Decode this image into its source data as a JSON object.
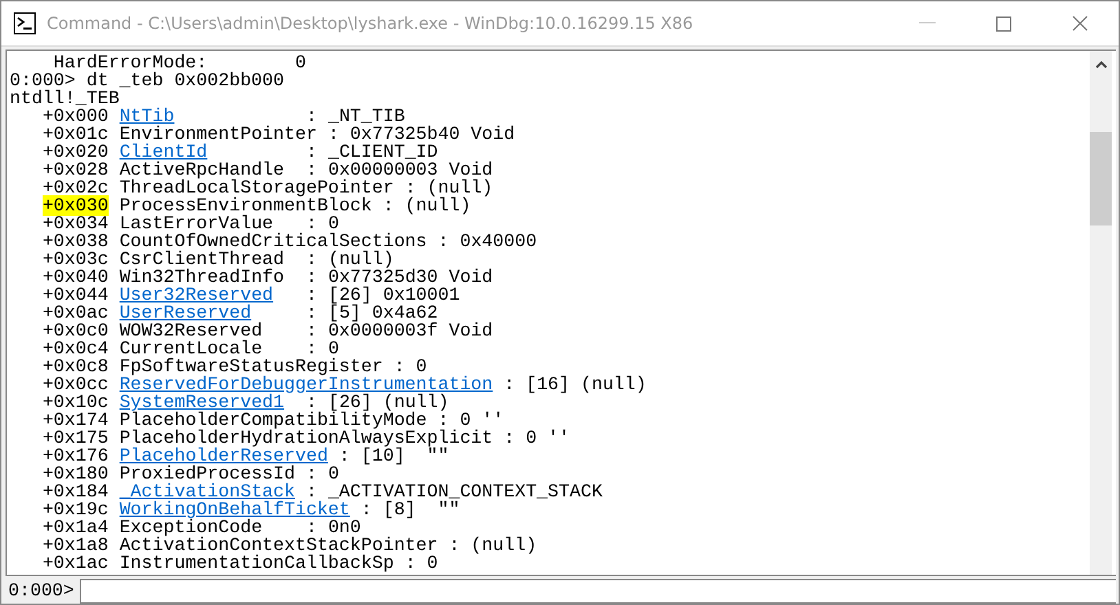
{
  "window": {
    "title": "Command - C:\\Users\\admin\\Desktop\\lyshark.exe - WinDbg:10.0.16299.15 X86"
  },
  "output": [
    {
      "kind": "plain",
      "text": "    HardErrorMode:        0"
    },
    {
      "kind": "plain",
      "text": "0:000> dt _teb 0x002bb000"
    },
    {
      "kind": "plain",
      "text": "ntdll!_TEB"
    },
    {
      "kind": "field",
      "offset": "+0x000",
      "name": "NtTib",
      "link": true,
      "value": ": _NT_TIB",
      "highlighted": false
    },
    {
      "kind": "field",
      "offset": "+0x01c",
      "name": "EnvironmentPointer",
      "link": false,
      "value": ": 0x77325b40 Void",
      "highlighted": false
    },
    {
      "kind": "field",
      "offset": "+0x020",
      "name": "ClientId",
      "link": true,
      "value": ": _CLIENT_ID",
      "highlighted": false
    },
    {
      "kind": "field",
      "offset": "+0x028",
      "name": "ActiveRpcHandle",
      "link": false,
      "value": ": 0x00000003 Void",
      "highlighted": false
    },
    {
      "kind": "field",
      "offset": "+0x02c",
      "name": "ThreadLocalStoragePointer",
      "link": false,
      "value": ": (null)",
      "highlighted": false
    },
    {
      "kind": "field",
      "offset": "+0x030",
      "name": "ProcessEnvironmentBlock",
      "link": false,
      "value": ": (null)",
      "highlighted": true
    },
    {
      "kind": "field",
      "offset": "+0x034",
      "name": "LastErrorValue",
      "link": false,
      "value": ": 0",
      "highlighted": false
    },
    {
      "kind": "field",
      "offset": "+0x038",
      "name": "CountOfOwnedCriticalSections",
      "link": false,
      "value": ": 0x40000",
      "highlighted": false
    },
    {
      "kind": "field",
      "offset": "+0x03c",
      "name": "CsrClientThread",
      "link": false,
      "value": ": (null)",
      "highlighted": false
    },
    {
      "kind": "field",
      "offset": "+0x040",
      "name": "Win32ThreadInfo",
      "link": false,
      "value": ": 0x77325d30 Void",
      "highlighted": false
    },
    {
      "kind": "field",
      "offset": "+0x044",
      "name": "User32Reserved",
      "link": true,
      "value": ": [26] 0x10001",
      "highlighted": false
    },
    {
      "kind": "field",
      "offset": "+0x0ac",
      "name": "UserReserved",
      "link": true,
      "value": ": [5] 0x4a62",
      "highlighted": false
    },
    {
      "kind": "field",
      "offset": "+0x0c0",
      "name": "WOW32Reserved",
      "link": false,
      "value": ": 0x0000003f Void",
      "highlighted": false
    },
    {
      "kind": "field",
      "offset": "+0x0c4",
      "name": "CurrentLocale",
      "link": false,
      "value": ": 0",
      "highlighted": false
    },
    {
      "kind": "field",
      "offset": "+0x0c8",
      "name": "FpSoftwareStatusRegister",
      "link": false,
      "value": ": 0",
      "highlighted": false
    },
    {
      "kind": "field",
      "offset": "+0x0cc",
      "name": "ReservedForDebuggerInstrumentation",
      "link": true,
      "value": ": [16] (null)",
      "highlighted": false
    },
    {
      "kind": "field",
      "offset": "+0x10c",
      "name": "SystemReserved1",
      "link": true,
      "value": ": [26] (null)",
      "highlighted": false
    },
    {
      "kind": "field",
      "offset": "+0x174",
      "name": "PlaceholderCompatibilityMode",
      "link": false,
      "value": ": 0 ''",
      "highlighted": false
    },
    {
      "kind": "field",
      "offset": "+0x175",
      "name": "PlaceholderHydrationAlwaysExplicit",
      "link": false,
      "value": ": 0 ''",
      "highlighted": false
    },
    {
      "kind": "field",
      "offset": "+0x176",
      "name": "PlaceholderReserved",
      "link": true,
      "value": ": [10]  \"\"",
      "highlighted": false
    },
    {
      "kind": "field",
      "offset": "+0x180",
      "name": "ProxiedProcessId",
      "link": false,
      "value": ": 0",
      "highlighted": false
    },
    {
      "kind": "field",
      "offset": "+0x184",
      "name": "_ActivationStack",
      "link": true,
      "value": ": _ACTIVATION_CONTEXT_STACK",
      "highlighted": false
    },
    {
      "kind": "field",
      "offset": "+0x19c",
      "name": "WorkingOnBehalfTicket",
      "link": true,
      "value": ": [8]  \"\"",
      "highlighted": false
    },
    {
      "kind": "field",
      "offset": "+0x1a4",
      "name": "ExceptionCode",
      "link": false,
      "value": ": 0n0",
      "highlighted": false
    },
    {
      "kind": "field",
      "offset": "+0x1a8",
      "name": "ActivationContextStackPointer",
      "link": false,
      "value": ": (null)",
      "highlighted": false
    },
    {
      "kind": "field",
      "offset": "+0x1ac",
      "name": "InstrumentationCallbackSp",
      "link": false,
      "value": ": 0",
      "highlighted": false
    }
  ],
  "prompt": {
    "label": "0:000>"
  }
}
